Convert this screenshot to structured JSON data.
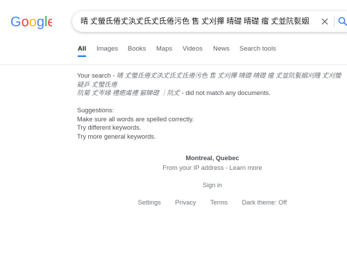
{
  "logo": {
    "text": "Google"
  },
  "search": {
    "query": "晴 𠀋螢氐倦𠀋汍𠀋氐𠀋氐倦污色 售 𠀋刈撣 晴礎 晴礎 瘤 𠀋並阬甏姻刈賤 𠀋刈螢疑乒 𠀋螢氐倦"
  },
  "tabs": [
    {
      "label": "All",
      "active": true
    },
    {
      "label": "Images"
    },
    {
      "label": "Books"
    },
    {
      "label": "Maps"
    },
    {
      "label": "Videos"
    },
    {
      "label": "News"
    },
    {
      "label": "Search tools"
    }
  ],
  "results": {
    "prefix": "Your search - ",
    "query_display_1": "晴 𠀋螢氐倦𠀋汍𠀋氐𠀋氐倦污色 售 𠀋刈撣 晴礎 晴礎 瘤 𠀋並阬甏姻刈賤 𠀋刈螢疑乒 𠀋螢氐倦",
    "query_display_2": "阬菊 𠀋岑緣 禮癒䖏禮 竅睇礎 ｜阬𠀋",
    "suffix": " - did not match any documents.",
    "suggestions_title": "Suggestions:",
    "suggestions": [
      "Make sure all words are spelled correctly.",
      "Try different keywords.",
      "Try more general keywords."
    ]
  },
  "footer": {
    "city": "Montreal, Quebec",
    "source": "From your IP address",
    "separator": " - ",
    "learn_more": "Learn more",
    "sign_in": "Sign in",
    "links": [
      "Settings",
      "Privacy",
      "Terms",
      "Dark theme: Off"
    ]
  },
  "colors": {
    "accent": "#1a73e8"
  },
  "icons": {
    "clear": "close-icon",
    "search": "search-icon"
  }
}
